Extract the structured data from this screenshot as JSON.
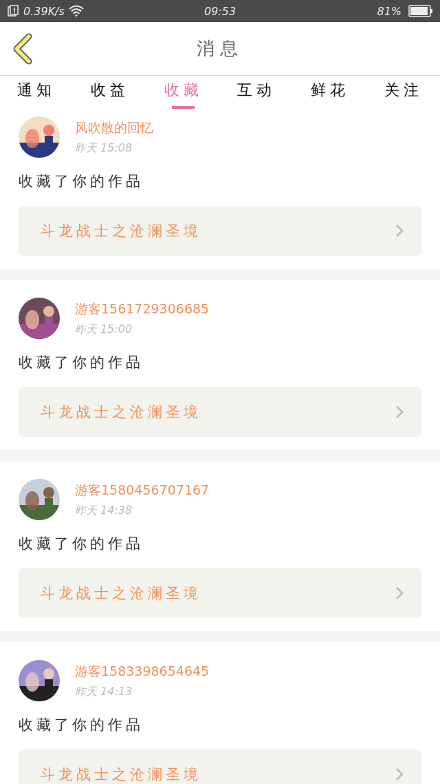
{
  "status_bar": {
    "speed": "0.39K/s",
    "time": "09:53",
    "battery": "81%"
  },
  "header": {
    "title": "消息"
  },
  "tabs": [
    {
      "label": "通知",
      "selected": false
    },
    {
      "label": "收益",
      "selected": false
    },
    {
      "label": "收藏",
      "selected": true
    },
    {
      "label": "互动",
      "selected": false
    },
    {
      "label": "鲜花",
      "selected": false
    },
    {
      "label": "关注",
      "selected": false
    }
  ],
  "messages": [
    {
      "name": "风吹散的回忆",
      "time": "昨天 15:08",
      "text": "收藏了你的作品",
      "work": "斗龙战士之沧澜圣境"
    },
    {
      "name": "游客1561729306685",
      "time": "昨天 15:00",
      "text": "收藏了你的作品",
      "work": "斗龙战士之沧澜圣境"
    },
    {
      "name": "游客1580456707167",
      "time": "昨天 14:38",
      "text": "收藏了你的作品",
      "work": "斗龙战士之沧澜圣境"
    },
    {
      "name": "游客1583398654645",
      "time": "昨天 14:13",
      "text": "收藏了你的作品",
      "work": "斗龙战士之沧澜圣境"
    }
  ]
}
